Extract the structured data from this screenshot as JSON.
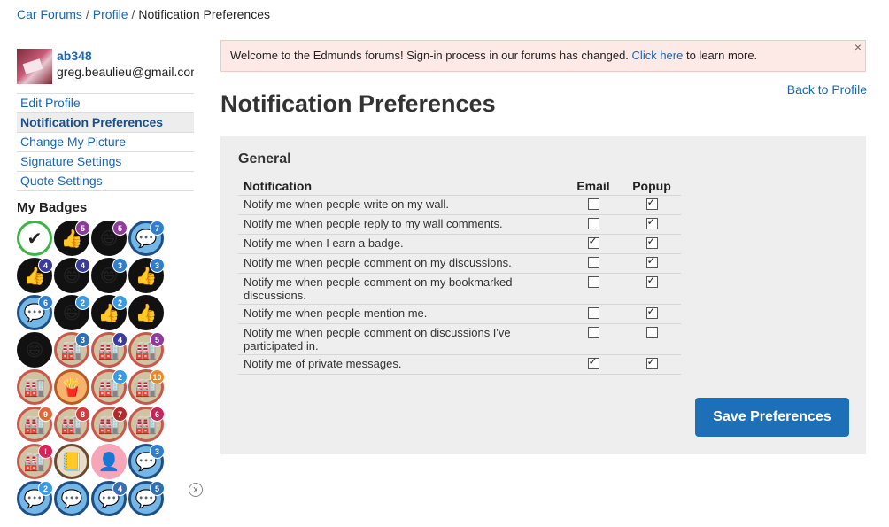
{
  "breadcrumb": {
    "car_forums": "Car Forums",
    "profile": "Profile",
    "current": "Notification Preferences",
    "separator": "/"
  },
  "user": {
    "username": "ab348",
    "email": "greg.beaulieu@gmail.com"
  },
  "nav": {
    "edit_profile": "Edit Profile",
    "notification_preferences": "Notification Preferences",
    "change_picture": "Change My Picture",
    "signature_settings": "Signature Settings",
    "quote_settings": "Quote Settings"
  },
  "badges": {
    "title": "My Badges",
    "counts": [
      "",
      "5",
      "5",
      "7",
      "4",
      "4",
      "3",
      "3",
      "6",
      "2",
      "2",
      "",
      "",
      "3",
      "4",
      "5",
      "",
      "",
      "2",
      "10",
      "9",
      "8",
      "7",
      "6",
      "!",
      "",
      "",
      "3",
      "2",
      "",
      "4",
      "5"
    ],
    "close": "x"
  },
  "alert": {
    "text_before": "Welcome to the Edmunds forums! Sign-in process in our forums has changed.",
    "link": "Click here",
    "text_after": "to learn more.",
    "dismiss": "×"
  },
  "back_to_profile": "Back to Profile",
  "page_title": "Notification Preferences",
  "panel": {
    "title": "General",
    "headers": {
      "notification": "Notification",
      "email": "Email",
      "popup": "Popup"
    },
    "rows": [
      {
        "label": "Notify me when people write on my wall.",
        "email": false,
        "popup": true
      },
      {
        "label": "Notify me when people reply to my wall comments.",
        "email": false,
        "popup": true
      },
      {
        "label": "Notify me when I earn a badge.",
        "email": true,
        "popup": true
      },
      {
        "label": "Notify me when people comment on my discussions.",
        "email": false,
        "popup": true
      },
      {
        "label": "Notify me when people comment on my bookmarked discussions.",
        "email": false,
        "popup": true
      },
      {
        "label": "Notify me when people mention me.",
        "email": false,
        "popup": true
      },
      {
        "label": "Notify me when people comment on discussions I've participated in.",
        "email": false,
        "popup": false
      },
      {
        "label": "Notify me of private messages.",
        "email": true,
        "popup": true
      }
    ],
    "save_label": "Save Preferences"
  }
}
